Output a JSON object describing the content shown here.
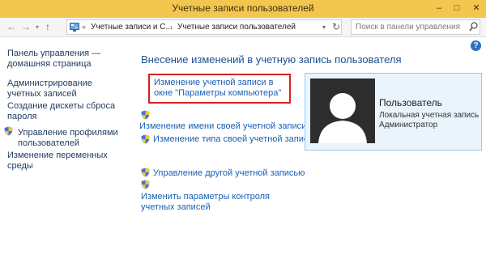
{
  "window": {
    "title": "Учетные записи пользователей",
    "minimize": "–",
    "maximize": "□",
    "close": "✕"
  },
  "nav": {
    "back": "←",
    "forward": "→",
    "up": "↑"
  },
  "address": {
    "prefix": "«",
    "crumbs": [
      "Учетные записи и С...",
      "Учетные записи пользователей"
    ],
    "separator": "›"
  },
  "search": {
    "placeholder": "Поиск в панели управления"
  },
  "help": {
    "label": "?"
  },
  "sidebar": {
    "items": [
      {
        "label": "Панель управления — домашняя страница",
        "shield": false
      },
      {
        "label": "Администрирование учетных записей",
        "shield": false
      },
      {
        "label": "Создание дискеты сброса пароля",
        "shield": false
      },
      {
        "label": "Управление профилями пользователей",
        "shield": true
      },
      {
        "label": "Изменение переменных среды",
        "shield": false
      }
    ]
  },
  "main": {
    "heading": "Внесение изменений в учетную запись пользователя",
    "links": [
      {
        "label": "Изменение учетной записи в окне \"Параметры компьютера\"",
        "shield": false,
        "highlighted": true
      },
      {
        "label": "Изменение имени своей учетной записи",
        "shield": true
      },
      {
        "label": "Изменение типа своей учетной записи",
        "shield": true
      },
      {
        "label": "Управление другой учетной записью",
        "shield": true
      },
      {
        "label": "Изменить параметры контроля учетных записей",
        "shield": true
      }
    ]
  },
  "user": {
    "name": "Пользователь",
    "account_type": "Локальная учетная запись",
    "role": "Администратор"
  },
  "colors": {
    "titlebar": "#f3c74f",
    "link": "#1a5fb4",
    "heading": "#1e4f8e",
    "highlight": "#d92020",
    "user_panel_bg": "#eaf4fc",
    "user_panel_border": "#9cc9ec",
    "avatar_bg": "#2d2d2d"
  }
}
